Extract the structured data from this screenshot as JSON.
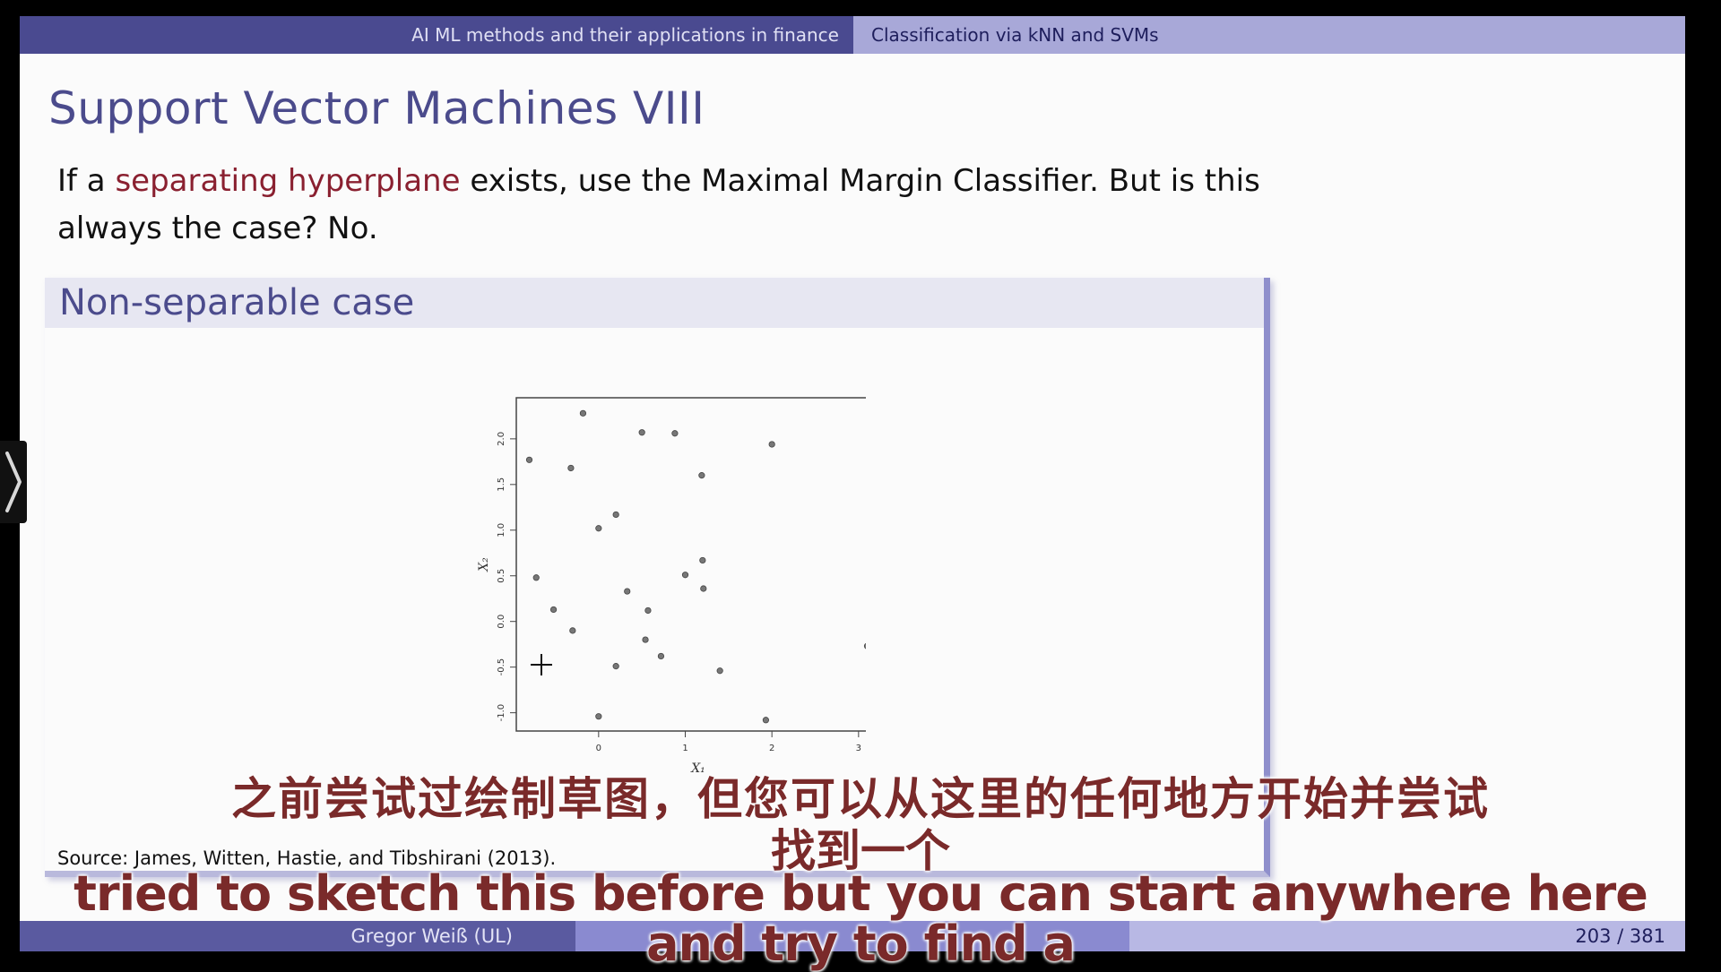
{
  "header": {
    "left": "AI ML methods and their applications in finance",
    "right": "Classification via kNN and SVMs"
  },
  "frame": {
    "title": "Support Vector Machines VIII",
    "intro_pre": "If a ",
    "intro_highlight": "separating hyperplane",
    "intro_post": " exists, use the Maximal Margin Classifier. But is this always the case? No.",
    "highlight_color": "#8a2030"
  },
  "block": {
    "title": "Non-separable case",
    "source": "Source: James, Witten, Hastie, and Tibshirani (2013)."
  },
  "chart_data": {
    "type": "scatter",
    "xlabel": "X₁",
    "ylabel": "X₂",
    "xlim": [
      -0.95,
      3.25
    ],
    "ylim": [
      -1.2,
      2.45
    ],
    "xticks": [
      "0",
      "1",
      "2",
      "3"
    ],
    "yticks": [
      "-1.0",
      "-0.5",
      "0.0",
      "0.5",
      "1.0",
      "1.5",
      "2.0"
    ],
    "points": [
      {
        "x": -0.8,
        "y": 1.77
      },
      {
        "x": -0.18,
        "y": 2.28
      },
      {
        "x": -0.32,
        "y": 1.68
      },
      {
        "x": 0.5,
        "y": 2.07
      },
      {
        "x": 0.88,
        "y": 2.06
      },
      {
        "x": 2.0,
        "y": 1.94
      },
      {
        "x": 1.19,
        "y": 1.6
      },
      {
        "x": 0.2,
        "y": 1.17
      },
      {
        "x": 0.0,
        "y": 1.02
      },
      {
        "x": -0.72,
        "y": 0.48
      },
      {
        "x": 1.2,
        "y": 0.67
      },
      {
        "x": 1.0,
        "y": 0.51
      },
      {
        "x": 1.21,
        "y": 0.36
      },
      {
        "x": 0.33,
        "y": 0.33
      },
      {
        "x": -0.52,
        "y": 0.13
      },
      {
        "x": 0.57,
        "y": 0.12
      },
      {
        "x": -0.3,
        "y": -0.1
      },
      {
        "x": 0.54,
        "y": -0.2
      },
      {
        "x": 0.72,
        "y": -0.38
      },
      {
        "x": 0.2,
        "y": -0.49
      },
      {
        "x": 1.4,
        "y": -0.54
      },
      {
        "x": 3.1,
        "y": -0.27
      },
      {
        "x": 0.0,
        "y": -1.04
      },
      {
        "x": 1.93,
        "y": -1.08
      }
    ]
  },
  "footer": {
    "author": "Gregor Weiß  (UL)",
    "page": "203 / 381"
  },
  "subtitles": {
    "zh_line1": "之前尝试过绘制草图，但您可以从这里的任何地方开始并尝试",
    "zh_line2": "找到一个",
    "en_line1": "tried to sketch this before but you can start anywhere here",
    "en_line2": "and try to find a"
  },
  "nav": {
    "icon": "chevron-right-icon"
  }
}
